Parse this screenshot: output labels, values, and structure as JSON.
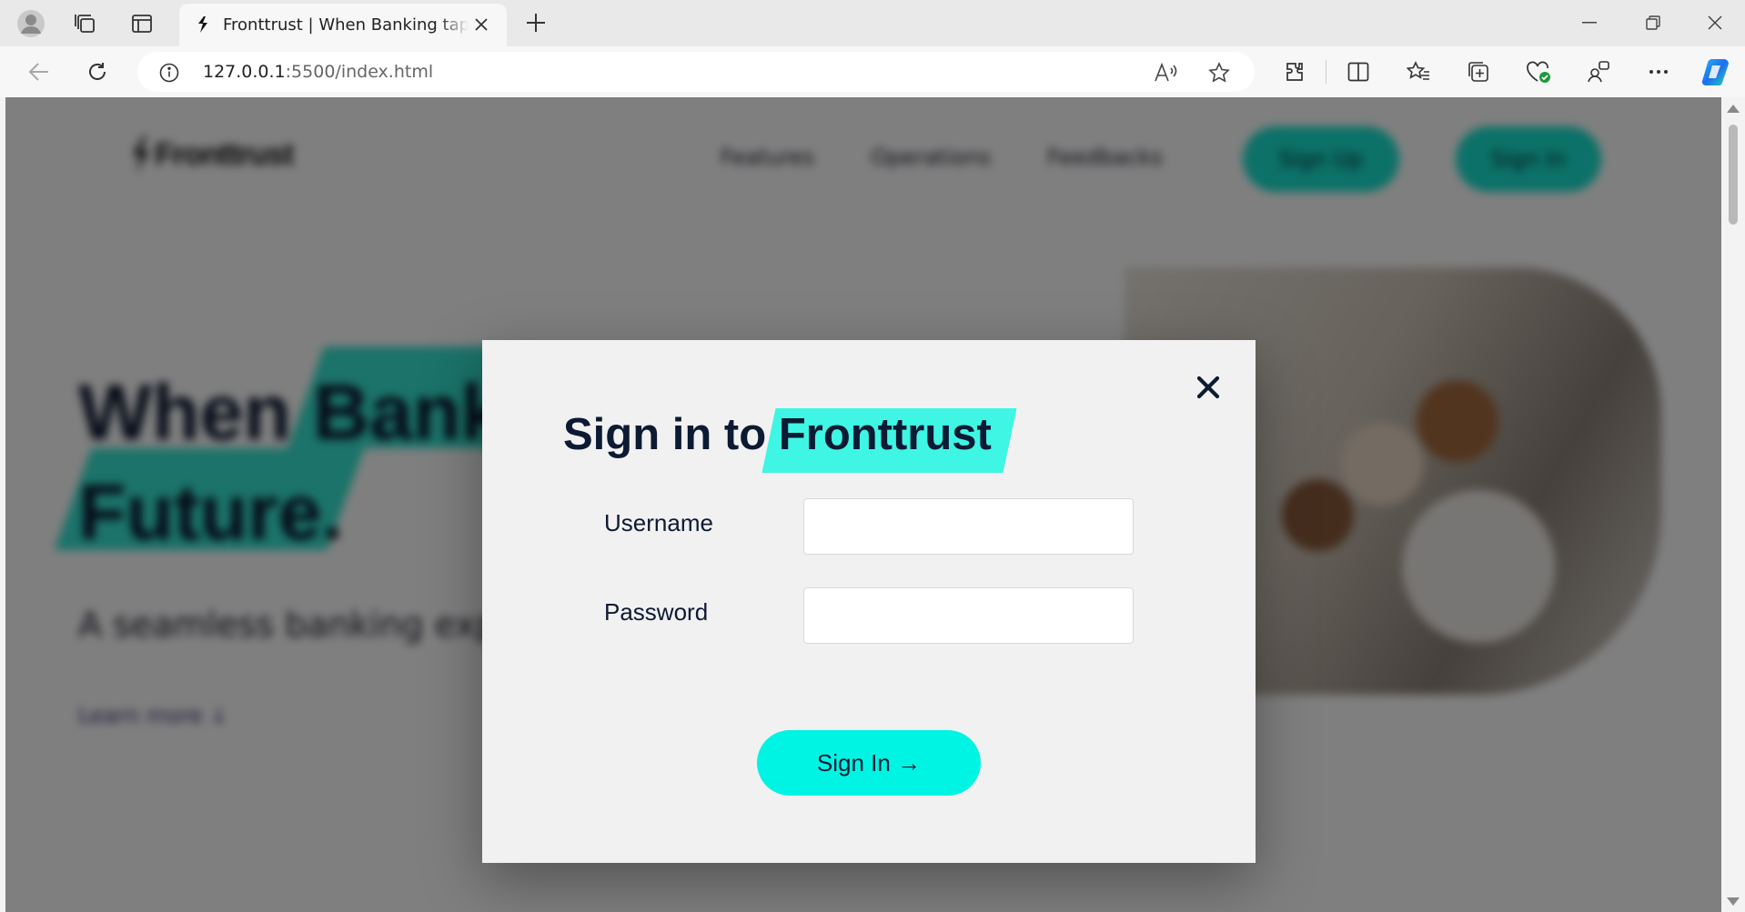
{
  "browser": {
    "tab_title": "Fronttrust | When Banking taps Future.",
    "url_host": "127.0.0.1",
    "url_path": ":5500/index.html"
  },
  "site": {
    "logo_text": "Fronttrust",
    "nav": [
      "Features",
      "Operations",
      "Feedbacks"
    ],
    "signup_label": "Sign Up",
    "signin_label": "Sign In",
    "hero_line1_a": "When",
    "hero_line1_b": "Banking",
    "hero_line2": "Future.",
    "hero_sub": "A seamless banking experience.",
    "hero_link": "Learn more ↓"
  },
  "modal": {
    "heading_prefix": "Sign in to",
    "heading_brand": "Fronttrust",
    "username_label": "Username",
    "password_label": "Password",
    "submit_label": "Sign In →"
  },
  "colors": {
    "accent": "#00f4e3",
    "heading": "#0c1a33",
    "modal_bg": "#f1f1f1"
  },
  "icons": [
    "profile-icon",
    "collections-icon",
    "tab-actions-icon",
    "tab-favicon",
    "close-tab-icon",
    "new-tab-icon",
    "minimize-icon",
    "restore-icon",
    "close-window-icon",
    "back-icon",
    "refresh-icon",
    "site-info-icon",
    "read-aloud-icon",
    "favorite-star-icon",
    "extensions-icon",
    "split-screen-icon",
    "favorites-icon",
    "collections-add-icon",
    "browser-essentials-icon",
    "profile-share-icon",
    "more-icon",
    "copilot-icon",
    "modal-close-icon"
  ]
}
